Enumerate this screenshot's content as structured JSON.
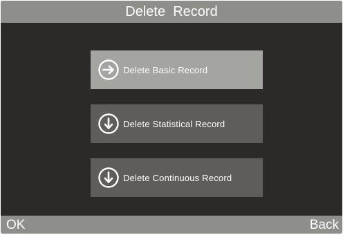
{
  "title": "Delete  Record",
  "menu": {
    "items": [
      {
        "label": "Delete Basic Record",
        "icon": "arrow-right-circle-icon",
        "selected": true
      },
      {
        "label": "Delete Statistical Record",
        "icon": "arrow-down-circle-icon",
        "selected": false
      },
      {
        "label": "Delete Continuous Record",
        "icon": "arrow-down-circle-icon",
        "selected": false
      }
    ]
  },
  "softkeys": {
    "left": "OK",
    "right": "Back"
  },
  "colors": {
    "bar": "#8e8e8b",
    "background": "#2b2a28",
    "button": "#5e5d5b",
    "button_selected": "#a4a4a1",
    "text": "#ffffff"
  }
}
